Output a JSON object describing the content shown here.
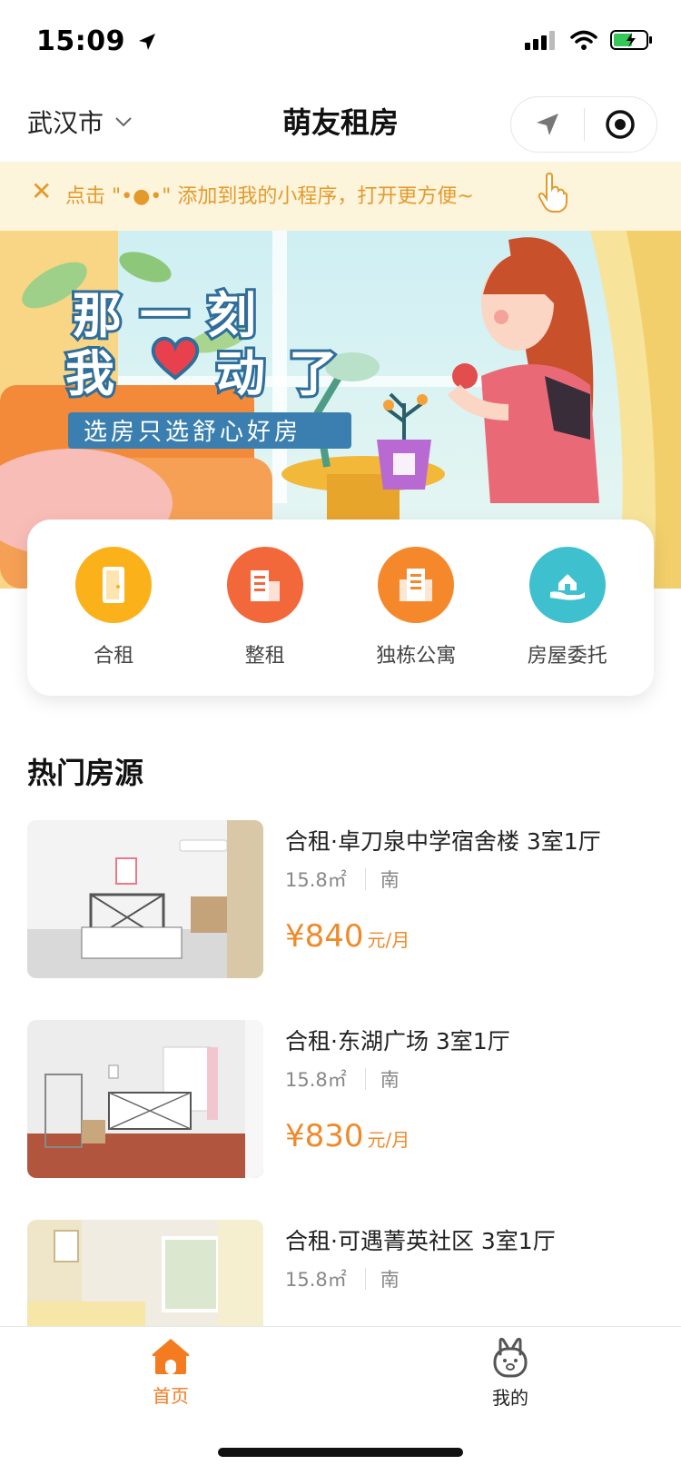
{
  "status": {
    "time": "15:09"
  },
  "nav": {
    "city": "武汉市",
    "title": "萌友租房"
  },
  "tip": {
    "close": "✕",
    "text": "点击 \"•●•\" 添加到我的小程序，打开更方便~"
  },
  "hero": {
    "line1": "那一刻",
    "line2_a": "我",
    "line2_b": "动了",
    "subtitle": "选房只选舒心好房"
  },
  "categories": [
    {
      "label": "合租",
      "color": "#fbb21a"
    },
    {
      "label": "整租",
      "color": "#f2683b"
    },
    {
      "label": "独栋公寓",
      "color": "#f5882b"
    },
    {
      "label": "房屋委托",
      "color": "#3fc0cf"
    }
  ],
  "section": {
    "title": "热门房源"
  },
  "listings": [
    {
      "title": "合租·卓刀泉中学宿舍楼 3室1厅",
      "area": "15.8㎡",
      "orientation": "南",
      "price": "¥840",
      "unit": "元/月"
    },
    {
      "title": "合租·东湖广场 3室1厅",
      "area": "15.8㎡",
      "orientation": "南",
      "price": "¥830",
      "unit": "元/月"
    },
    {
      "title": "合租·可遇菁英社区 3室1厅",
      "area": "15.8㎡",
      "orientation": "南",
      "price": "",
      "unit": ""
    }
  ],
  "tabs": {
    "home": "首页",
    "mine": "我的"
  },
  "colors": {
    "accent": "#ef8a2a",
    "tip_bg": "#fdf4dc"
  }
}
